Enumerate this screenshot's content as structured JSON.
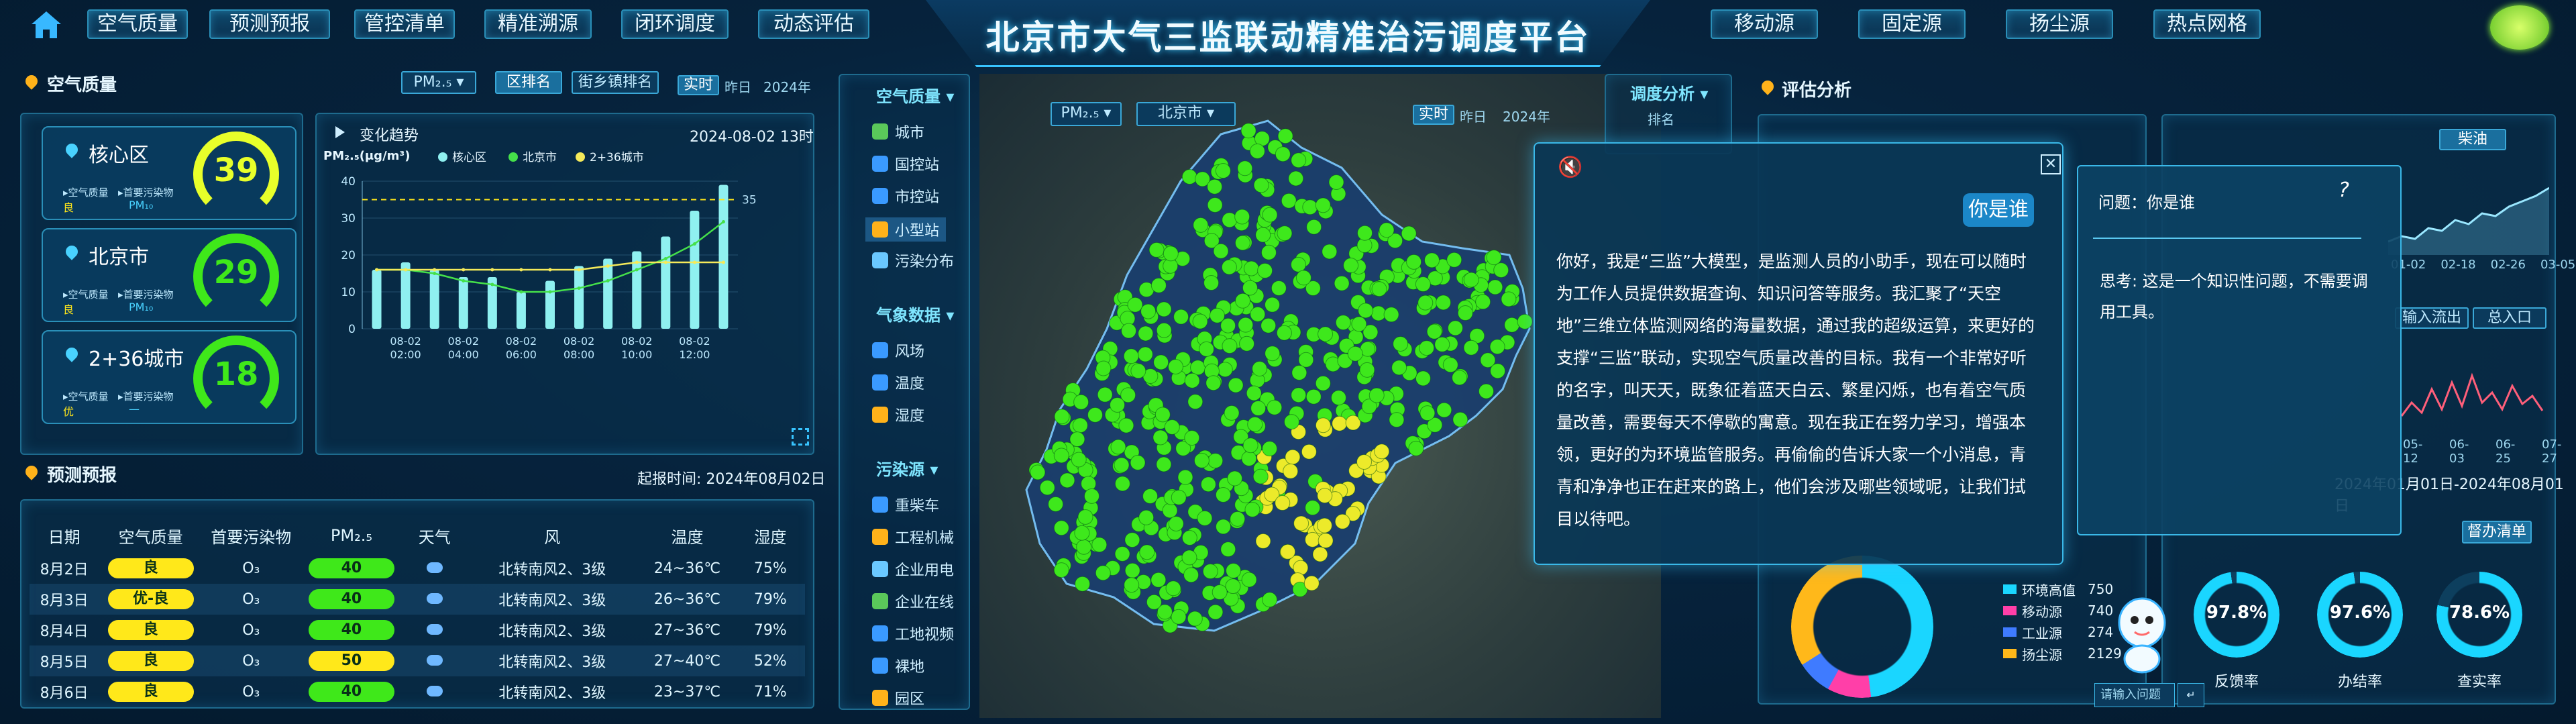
{
  "header": {
    "title": "北京市大气三监联动精准治污调度平台",
    "nav_left": [
      "空气质量",
      "预测预报",
      "管控清单",
      "精准溯源",
      "闭环调度",
      "动态评估"
    ],
    "nav_right": [
      "移动源",
      "固定源",
      "扬尘源",
      "热点网格"
    ]
  },
  "air_quality": {
    "title": "空气质量",
    "pollutant_select": "PM₂.₅",
    "tab_district": "区排名",
    "tab_street": "街乡镇排名",
    "tab_realtime": "实时",
    "tab_yesterday": "昨日",
    "tab_year": "2024年",
    "regions": [
      {
        "name": "核心区",
        "value": "39",
        "aq_label": "空气质量",
        "aq": "良",
        "pp_label": "首要污染物",
        "pp": "PM₁₀",
        "color": "#e8ff2a"
      },
      {
        "name": "北京市",
        "value": "29",
        "aq_label": "空气质量",
        "aq": "良",
        "pp_label": "首要污染物",
        "pp": "PM₁₀",
        "color": "#3fe81a"
      },
      {
        "name": "2+36城市",
        "value": "18",
        "aq_label": "空气质量",
        "aq": "优",
        "pp_label": "首要污染物",
        "pp": "—",
        "color": "#3fe81a"
      }
    ]
  },
  "trend": {
    "title": "变化趋势",
    "date": "2024-08-02 13时"
  },
  "chart_data": {
    "type": "bar",
    "title": "变化趋势",
    "ylabel": "PM₂.₅(μg/m³)",
    "ylim": [
      0,
      40
    ],
    "yticks": [
      0,
      10,
      20,
      30,
      40
    ],
    "x": [
      "08-02 01:00",
      "08-02 02:00",
      "08-02 03:00",
      "08-02 04:00",
      "08-02 05:00",
      "08-02 06:00",
      "08-02 07:00",
      "08-02 08:00",
      "08-02 09:00",
      "08-02 10:00",
      "08-02 11:00",
      "08-02 12:00",
      "08-02 13:00"
    ],
    "xticklabels": [
      "08-02\n02:00",
      "08-02\n04:00",
      "08-02\n06:00",
      "08-02\n08:00",
      "08-02\n10:00",
      "08-02\n12:00"
    ],
    "series": [
      {
        "name": "核心区",
        "type": "bar",
        "color": "#8ff0f0",
        "values": [
          16,
          18,
          16,
          14,
          14,
          10,
          13,
          17,
          19,
          21,
          25,
          32,
          39
        ]
      },
      {
        "name": "北京市",
        "type": "line",
        "color": "#45e04a",
        "values": [
          16,
          16,
          15,
          13,
          12,
          10,
          10,
          11,
          13,
          16,
          19,
          23,
          29
        ]
      },
      {
        "name": "2+36城市",
        "type": "line",
        "color": "#f5ea5a",
        "values": [
          16,
          16,
          16,
          16,
          16,
          16,
          16,
          16,
          17,
          18,
          18,
          18,
          18
        ]
      }
    ],
    "threshold": {
      "value": 35,
      "label": "35",
      "color": "#ffe61a"
    }
  },
  "forecast": {
    "title": "预测预报",
    "time_label": "起报时间:",
    "time": "2024年08月02日",
    "headers": [
      "日期",
      "空气质量",
      "首要污染物",
      "PM₂.₅",
      "天气",
      "风",
      "温度",
      "湿度"
    ],
    "rows": [
      {
        "date": "8月2日",
        "aq": "良",
        "pp": "O₃",
        "pm": "40",
        "wind": "北转南风2、3级",
        "temp": "24~36℃",
        "hum": "75%",
        "aqc": "#ffe81a",
        "pmc": "#3fe81a"
      },
      {
        "date": "8月3日",
        "aq": "优-良",
        "pp": "O₃",
        "pm": "40",
        "wind": "北转南风2、3级",
        "temp": "26~36℃",
        "hum": "79%",
        "aqc": "#ffe81a",
        "pmc": "#3fe81a"
      },
      {
        "date": "8月4日",
        "aq": "良",
        "pp": "O₃",
        "pm": "40",
        "wind": "北转南风2、3级",
        "temp": "27~36℃",
        "hum": "79%",
        "aqc": "#ffe81a",
        "pmc": "#3fe81a"
      },
      {
        "date": "8月5日",
        "aq": "良",
        "pp": "O₃",
        "pm": "50",
        "wind": "北转南风2、3级",
        "temp": "27~40℃",
        "hum": "52%",
        "aqc": "#ffe81a",
        "pmc": "#ffe81a"
      },
      {
        "date": "8月6日",
        "aq": "良",
        "pp": "O₃",
        "pm": "40",
        "wind": "北转南风2、3级",
        "temp": "23~37℃",
        "hum": "71%",
        "aqc": "#ffe81a",
        "pmc": "#3fe81a"
      }
    ]
  },
  "sidebar": {
    "sections": [
      {
        "title": "空气质量",
        "items": [
          "城市",
          "国控站",
          "市控站",
          "小型站",
          "污染分布"
        ]
      },
      {
        "title": "气象数据",
        "items": [
          "风场",
          "温度",
          "湿度"
        ]
      },
      {
        "title": "污染源",
        "items": [
          "重柴车",
          "工程机械",
          "企业用电",
          "企业在线",
          "工地视频",
          "裸地",
          "园区"
        ]
      }
    ]
  },
  "map": {
    "pollutant": "PM₂.₅",
    "region": "北京市",
    "realtime": "实时",
    "yesterday": "昨日",
    "year": "2024年"
  },
  "schedule": {
    "title": "调度分析",
    "rank": "排名"
  },
  "assess": {
    "title": "评估分析",
    "date_range": "2024年01月01日-2024年08月01日",
    "chips": [
      "总入口",
      "输入流出"
    ],
    "tab": "柴油",
    "xlabels": [
      "01-02",
      "02-18",
      "02-26",
      "03-05"
    ],
    "xlabels2": [
      "05-12",
      "06-03",
      "06-25",
      "07-27"
    ],
    "legend": [
      {
        "label": "环境高值",
        "value": "750",
        "color": "#1ad6ff"
      },
      {
        "label": "移动源",
        "value": "740",
        "color": "#ff3fa8"
      },
      {
        "label": "工业源",
        "value": "274",
        "color": "#3f7bff"
      },
      {
        "label": "扬尘源",
        "value": "2129",
        "color": "#ffb81a"
      }
    ],
    "todo": "督办清单",
    "rings": [
      {
        "value": "97.8%",
        "label": "反馈率"
      },
      {
        "value": "97.6%",
        "label": "办结率"
      },
      {
        "value": "78.6%",
        "label": "查实率"
      }
    ]
  },
  "chat": {
    "question_bubble": "你是谁",
    "answer": "你好，我是“三监”大模型，是监测人员的小助手，现在可以随时为工作人员提供数据查询、知识问答等服务。我汇聚了“天空地”三维立体监测网络的海量数据，通过我的超级运算，来更好的支撑“三监”联动，实现空气质量改善的目标。我有一个非常好听的名字，叫天天，既象征着蓝天白云、繁星闪烁，也有着空气质量改善，需要每天不停歇的寓意。现在我正在努力学习，增强本领，更好的为环境监管服务。再偷偷的告诉大家一个小消息，青青和净净也正在赶来的路上，他们会涉及哪些领域呢，让我们拭目以待吧。",
    "side_q": "问题：你是谁",
    "side_think": "思考: 这是一个知识性问题，不需要调用工具。",
    "input_placeholder": "请输入问题"
  }
}
